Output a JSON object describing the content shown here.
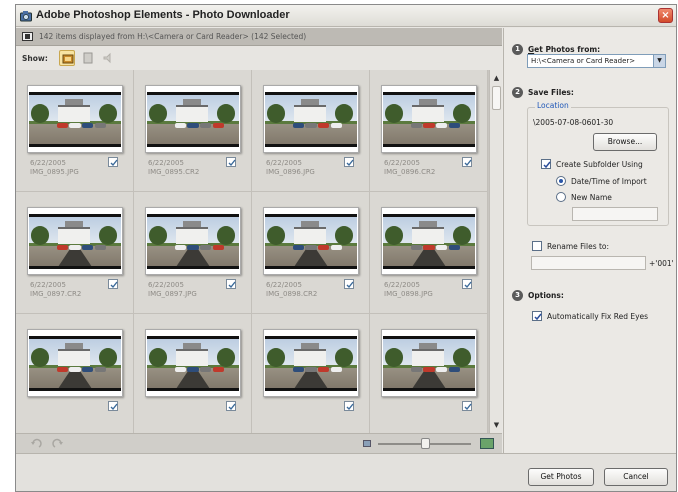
{
  "window": {
    "title": "Adobe Photoshop Elements - Photo Downloader",
    "close_glyph": "×"
  },
  "info_bar": {
    "text": "142 items displayed from H:\\<Camera or Card Reader> (142 Selected)"
  },
  "show": {
    "label": "Show:"
  },
  "photos": [
    {
      "date": "6/22/2005",
      "name": "IMG_0895.JPG",
      "checked": true
    },
    {
      "date": "6/22/2005",
      "name": "IMG_0895.CR2",
      "checked": true
    },
    {
      "date": "6/22/2005",
      "name": "IMG_0896.JPG",
      "checked": true
    },
    {
      "date": "6/22/2005",
      "name": "IMG_0896.CR2",
      "checked": true
    },
    {
      "date": "6/22/2005",
      "name": "IMG_0897.CR2",
      "checked": true
    },
    {
      "date": "6/22/2005",
      "name": "IMG_0897.JPG",
      "checked": true
    },
    {
      "date": "6/22/2005",
      "name": "IMG_0898.CR2",
      "checked": true
    },
    {
      "date": "6/22/2005",
      "name": "IMG_0898.JPG",
      "checked": true
    },
    {
      "date": "",
      "name": "",
      "checked": true
    },
    {
      "date": "",
      "name": "",
      "checked": true
    },
    {
      "date": "",
      "name": "",
      "checked": true
    },
    {
      "date": "",
      "name": "",
      "checked": true
    }
  ],
  "zoom": {
    "level": 0.5
  },
  "sidebar": {
    "step1": {
      "number": "1",
      "label": "Get Photos from:",
      "source_value": "H:\\<Camera or Card Reader>"
    },
    "step2": {
      "number": "2",
      "label": "Save Files:",
      "group_title": "Location",
      "location_path": "\\2005-07-08-0601-30",
      "browse_label": "Browse...",
      "create_subfolder_label": "Create Subfolder Using",
      "create_subfolder_checked": true,
      "radio_date_label": "Date/Time of Import",
      "radio_new_label": "New Name",
      "rename_label": "Rename Files to:",
      "rename_checked": false,
      "rename_suffix": "+'001'"
    },
    "step3": {
      "number": "3",
      "label": "Options:",
      "fix_red_eyes_label": "Automatically Fix Red Eyes",
      "fix_red_eyes_checked": true
    }
  },
  "footer": {
    "get_photos_label": "Get Photos",
    "cancel_label": "Cancel"
  },
  "colors": {
    "accent": "#1f57b8",
    "panel": "#ebe9e5",
    "grid": "#dad8d3"
  }
}
